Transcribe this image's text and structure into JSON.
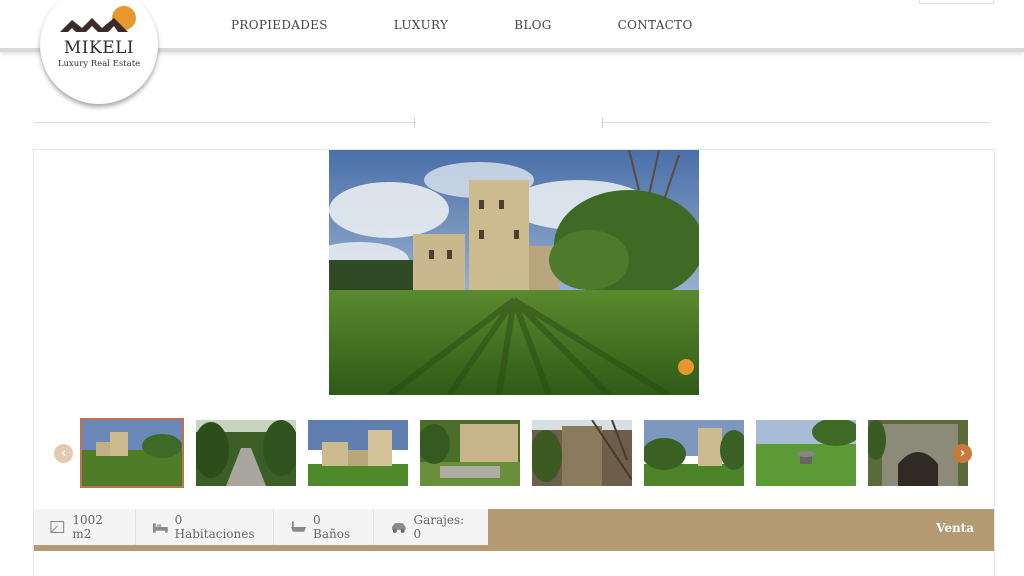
{
  "brand": {
    "name": "MIKELI",
    "tagline": "Luxury Real Estate",
    "colors": {
      "orange": "#e8972c",
      "dark": "#3b2c28",
      "accent": "#b49b73"
    }
  },
  "nav": {
    "items": [
      {
        "label": "PROPIEDADES"
      },
      {
        "label": "LUXURY"
      },
      {
        "label": "BLOG"
      },
      {
        "label": "CONTACTO"
      }
    ]
  },
  "gallery": {
    "main_image": "castle-tower-lawn-photo",
    "thumbnails": [
      {
        "name": "castle-lawn",
        "selected": true
      },
      {
        "name": "tree-lined-path",
        "selected": false
      },
      {
        "name": "castle-front",
        "selected": false
      },
      {
        "name": "castle-garden",
        "selected": false
      },
      {
        "name": "stone-wall-trees",
        "selected": false
      },
      {
        "name": "castle-far",
        "selected": false
      },
      {
        "name": "field-fountain",
        "selected": false
      },
      {
        "name": "stone-arch",
        "selected": false
      }
    ],
    "prev_icon": "chevron-left-icon",
    "next_icon": "chevron-right-icon"
  },
  "features": {
    "area": "1002 m2",
    "rooms": "0 Habitaciones",
    "baths": "0 Baños",
    "garages": "Garajes: 0",
    "operation": "Venta"
  }
}
